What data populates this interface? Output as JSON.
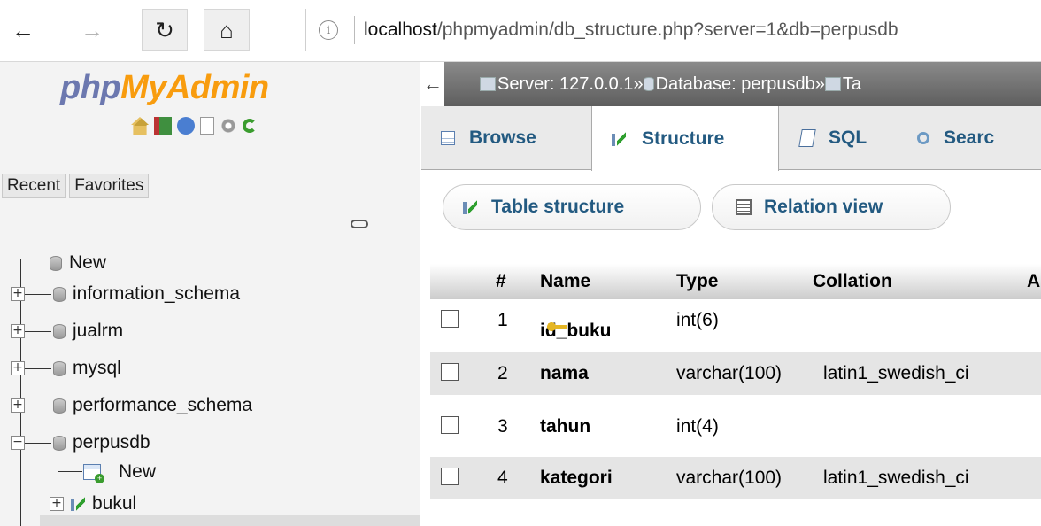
{
  "browser": {
    "back_icon": "←",
    "forward_icon": "→",
    "reload_icon": "↻",
    "home_icon": "⌂",
    "info_icon": "i",
    "url_host": "localhost",
    "url_rest": "/phpmyadmin/db_structure.php?server=1&db=perpusdb"
  },
  "sidebar": {
    "logo_part1": "php",
    "logo_part2": "MyAdmin",
    "recent_label": "Recent",
    "favorites_label": "Favorites",
    "tree": {
      "new_label": "New",
      "db1": "information_schema",
      "db2": "jualrm",
      "db3": "mysql",
      "db4": "performance_schema",
      "db5": "perpusdb",
      "sub_new": "New",
      "sub_table": "bukul"
    }
  },
  "main": {
    "crumb": {
      "back_icon": "←",
      "server_label": "Server: 127.0.0.1",
      "sep": " » ",
      "database_label": "Database: perpusdb",
      "table_prefix": "Ta"
    },
    "tabs": {
      "browse": "Browse",
      "structure": "Structure",
      "sql": "SQL",
      "search": "Searc"
    },
    "subtabs": {
      "table_structure": "Table structure",
      "relation_view": "Relation view"
    },
    "grid": {
      "headers": {
        "num": "#",
        "name": "Name",
        "type": "Type",
        "collation": "Collation",
        "attr": "A"
      },
      "rows": [
        {
          "num": "1",
          "name": "id_buku",
          "type": "int(6)",
          "collation": ""
        },
        {
          "num": "2",
          "name": "nama",
          "type": "varchar(100)",
          "collation": "latin1_swedish_ci"
        },
        {
          "num": "3",
          "name": "tahun",
          "type": "int(4)",
          "collation": ""
        },
        {
          "num": "4",
          "name": "kategori",
          "type": "varchar(100)",
          "collation": "latin1_swedish_ci"
        }
      ]
    }
  }
}
